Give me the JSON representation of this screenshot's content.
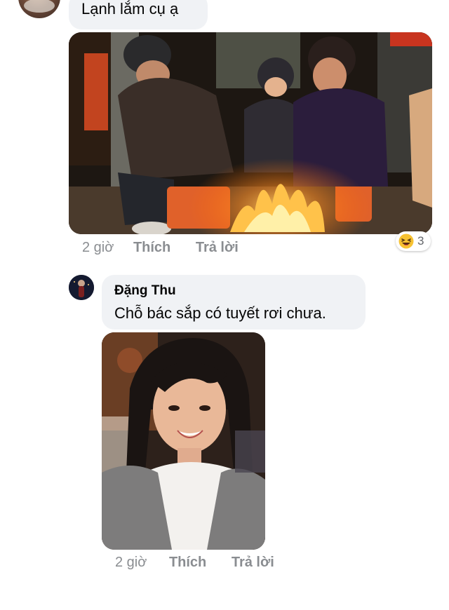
{
  "comments": [
    {
      "text": "Lạnh lắm cụ ạ",
      "meta": {
        "time": "2 giờ",
        "like": "Thích",
        "reply": "Trả lời"
      },
      "reaction": {
        "icon": "laughing-emoji-icon",
        "count": "3"
      }
    },
    {
      "author": "Đặng Thu",
      "text": "Chỗ bác sắp có tuyết rơi chưa.",
      "meta": {
        "time": "2 giờ",
        "like": "Thích",
        "reply": "Trả lời"
      }
    }
  ],
  "colors": {
    "bubble": "#f0f2f5",
    "meta": "#8a8d91",
    "text": "#050505"
  }
}
